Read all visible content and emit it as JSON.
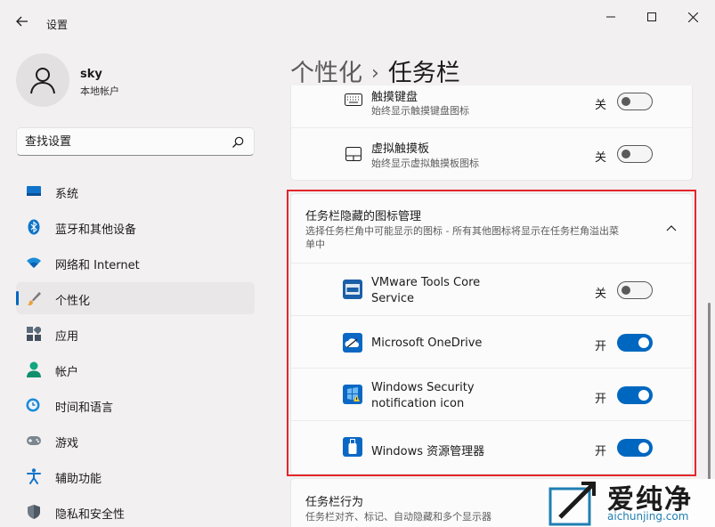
{
  "window": {
    "title": "设置"
  },
  "user": {
    "name": "sky",
    "account_type": "本地帐户"
  },
  "search": {
    "placeholder": "查找设置"
  },
  "nav": {
    "items": [
      {
        "label": "系统",
        "icon": "system-icon"
      },
      {
        "label": "蓝牙和其他设备",
        "icon": "bluetooth-icon"
      },
      {
        "label": "网络和 Internet",
        "icon": "wifi-icon"
      },
      {
        "label": "个性化",
        "icon": "brush-icon",
        "active": true
      },
      {
        "label": "应用",
        "icon": "apps-icon"
      },
      {
        "label": "帐户",
        "icon": "account-icon"
      },
      {
        "label": "时间和语言",
        "icon": "clock-globe-icon"
      },
      {
        "label": "游戏",
        "icon": "gamepad-icon"
      },
      {
        "label": "辅助功能",
        "icon": "accessibility-icon"
      },
      {
        "label": "隐私和安全性",
        "icon": "shield-icon"
      }
    ]
  },
  "breadcrumb": {
    "parent": "个性化",
    "separator": "›",
    "current": "任务栏"
  },
  "corner_icons": [
    {
      "title": "触摸键盘",
      "subtitle": "始终显示触摸键盘图标",
      "state": "关",
      "on": false,
      "icon": "keyboard-icon"
    },
    {
      "title": "虚拟触摸板",
      "subtitle": "始终显示虚拟触摸板图标",
      "state": "关",
      "on": false,
      "icon": "touchpad-icon"
    }
  ],
  "overflow": {
    "title": "任务栏隐藏的图标管理",
    "subtitle_line1": "选择任务栏角中可能显示的图标 - 所有其他图标将显示在任务栏角溢出菜",
    "subtitle_line2": "单中",
    "items": [
      {
        "line1": "VMware Tools Core",
        "line2": "Service",
        "state": "关",
        "on": false,
        "icon": "vmware-icon"
      },
      {
        "line1": "Microsoft OneDrive",
        "line2": "",
        "state": "开",
        "on": true,
        "icon": "onedrive-icon"
      },
      {
        "line1": "Windows Security",
        "line2": "notification icon",
        "state": "开",
        "on": true,
        "icon": "windows-security-icon"
      },
      {
        "line1": "Windows 资源管理器",
        "line2": "",
        "state": "开",
        "on": true,
        "icon": "usb-drive-icon"
      }
    ]
  },
  "behaviors": {
    "title": "任务栏行为",
    "subtitle": "任务栏对齐、标记、自动隐藏和多个显示器"
  },
  "watermark": {
    "brand": "爱纯净",
    "url": "aichunjing.com"
  },
  "colors": {
    "accent": "#0067c0",
    "highlight_border": "#e3262b",
    "background": "#f3f0f1"
  }
}
